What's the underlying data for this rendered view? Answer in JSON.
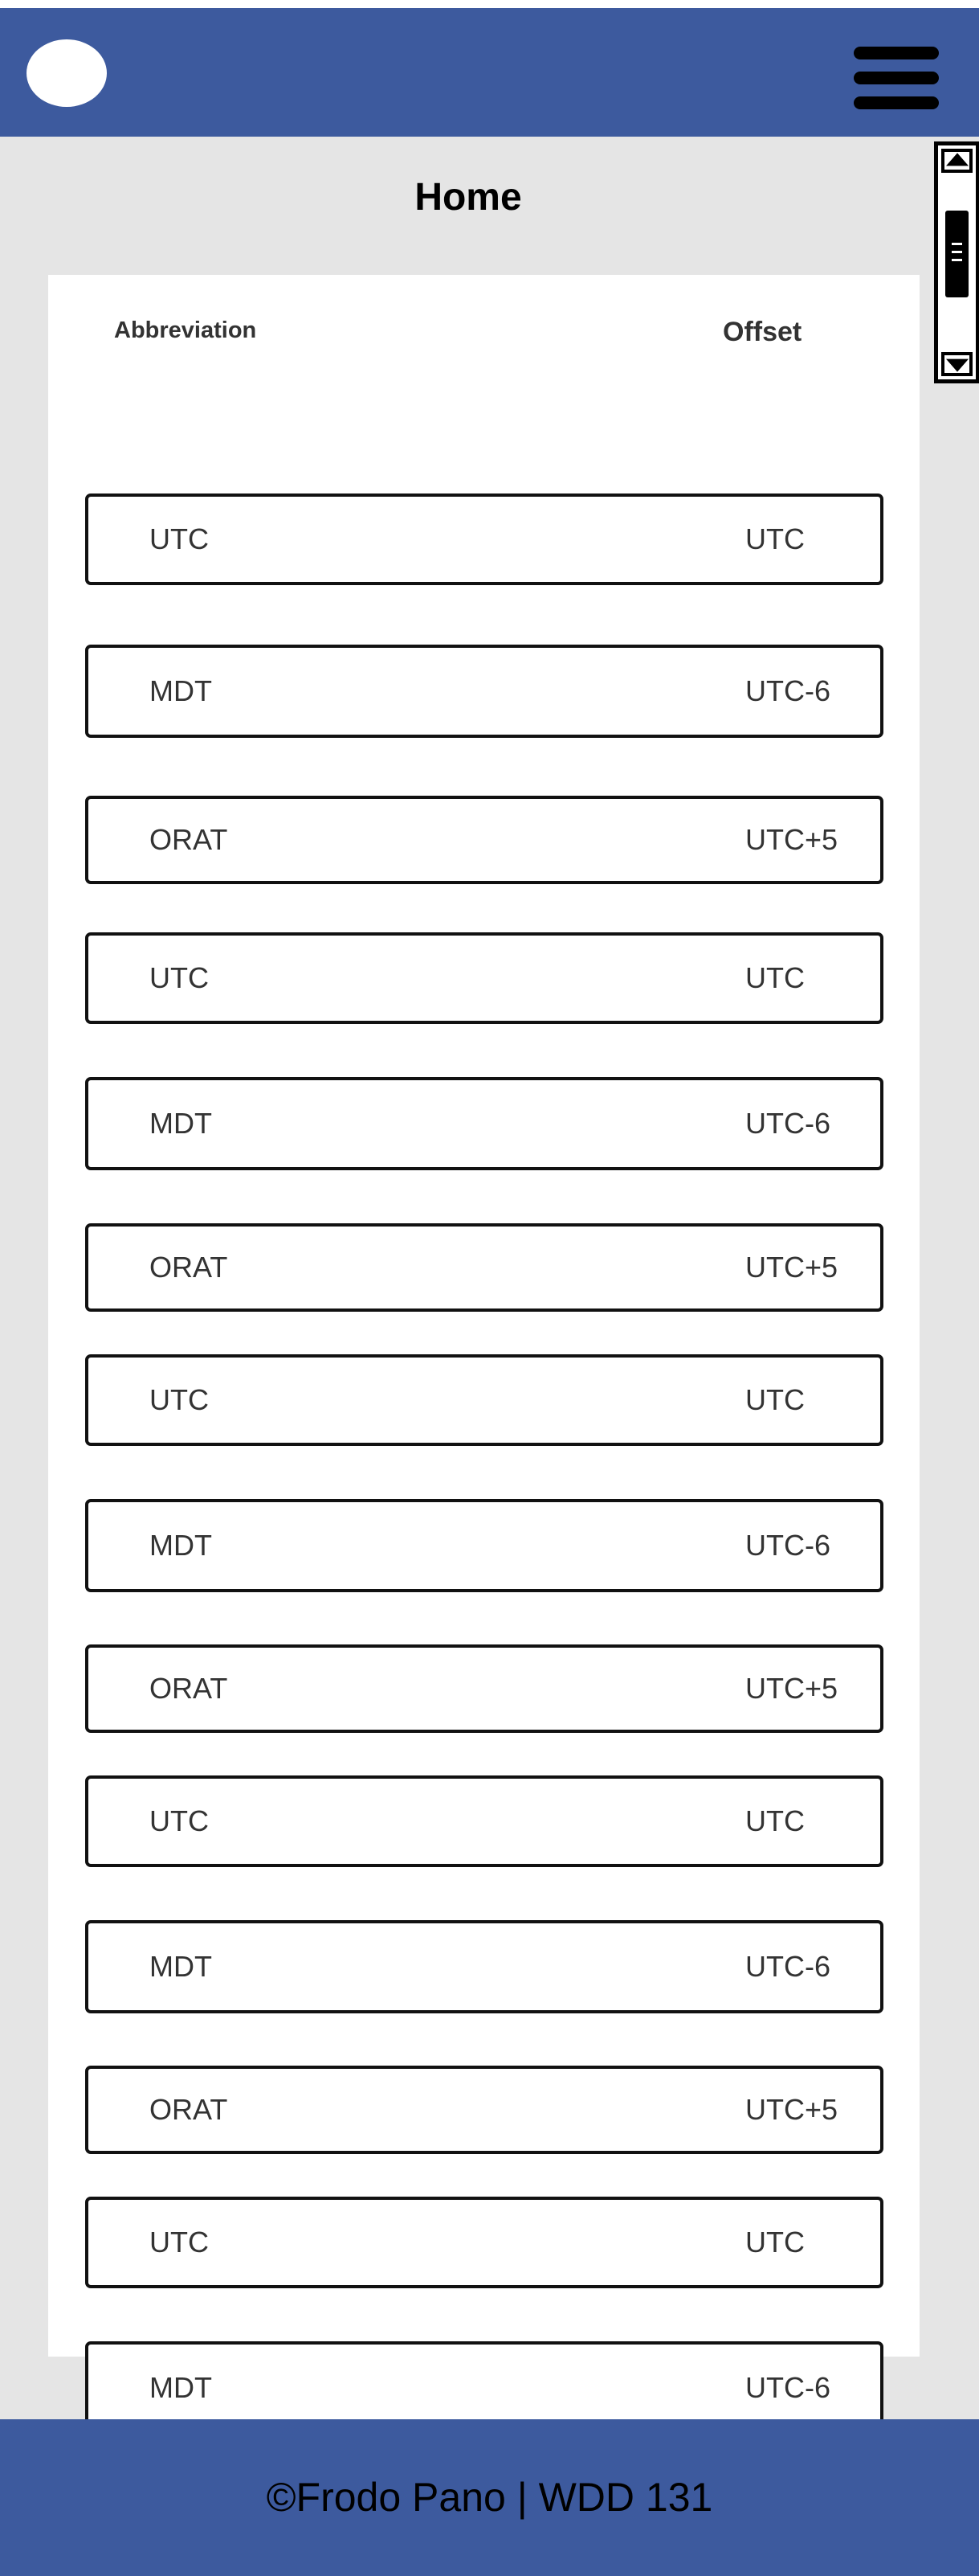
{
  "header": {
    "logo_icon": "logo-circle",
    "menu_icon": "hamburger-menu-icon",
    "color": "#3d5a9e"
  },
  "main": {
    "title": "Home",
    "columns": {
      "abbreviation": "Abbreviation",
      "offset": "Offset"
    },
    "rows": [
      {
        "abbr": "UTC",
        "offset": "UTC"
      },
      {
        "abbr": "MDT",
        "offset": "UTC-6"
      },
      {
        "abbr": "ORAT",
        "offset": "UTC+5"
      },
      {
        "abbr": "UTC",
        "offset": "UTC"
      },
      {
        "abbr": "MDT",
        "offset": "UTC-6"
      },
      {
        "abbr": "ORAT",
        "offset": "UTC+5"
      },
      {
        "abbr": "UTC",
        "offset": "UTC"
      },
      {
        "abbr": "MDT",
        "offset": "UTC-6"
      },
      {
        "abbr": "ORAT",
        "offset": "UTC+5"
      },
      {
        "abbr": "UTC",
        "offset": "UTC"
      },
      {
        "abbr": "MDT",
        "offset": "UTC-6"
      },
      {
        "abbr": "ORAT",
        "offset": "UTC+5"
      },
      {
        "abbr": "UTC",
        "offset": "UTC"
      },
      {
        "abbr": "MDT",
        "offset": "UTC-6"
      }
    ]
  },
  "footer": {
    "text": "©Frodo Pano | WDD 131"
  }
}
